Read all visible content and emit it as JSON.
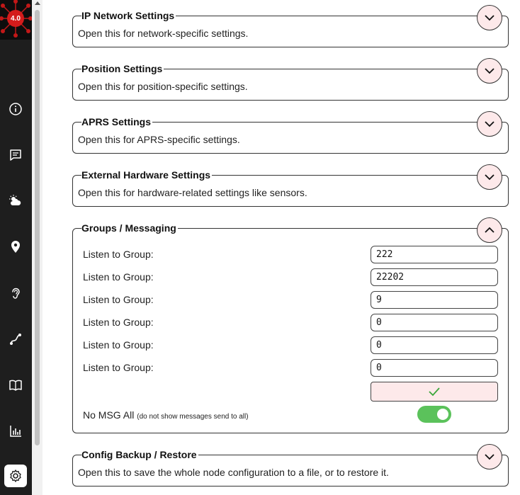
{
  "logo": {
    "version": "4.0"
  },
  "sections": {
    "ip": {
      "title": "IP Network Settings",
      "desc": "Open this for network-specific settings."
    },
    "position": {
      "title": "Position Settings",
      "desc": "Open this for position-specific settings."
    },
    "aprs": {
      "title": "APRS Settings",
      "desc": "Open this for APRS-specific settings."
    },
    "hardware": {
      "title": "External Hardware Settings",
      "desc": "Open this for hardware-related settings like sensors."
    },
    "groups": {
      "title": "Groups / Messaging",
      "rows": [
        {
          "label": "Listen to Group:",
          "value": "222"
        },
        {
          "label": "Listen to Group:",
          "value": "22202"
        },
        {
          "label": "Listen to Group:",
          "value": "9"
        },
        {
          "label": "Listen to Group:",
          "value": "0"
        },
        {
          "label": "Listen to Group:",
          "value": "0"
        },
        {
          "label": "Listen to Group:",
          "value": "0"
        }
      ],
      "no_msg_label": "No MSG All",
      "no_msg_note": "(do not show messages send to all)",
      "no_msg_enabled": true
    },
    "backup": {
      "title": "Config Backup / Restore",
      "desc": "Open this to save the whole node configuration to a file, or to restore it."
    }
  },
  "icons": {
    "nav": [
      "info-icon",
      "message-icon",
      "weather-icon",
      "location-pin-icon",
      "ear-icon",
      "route-icon",
      "book-icon",
      "chart-icon",
      "gear-icon"
    ]
  },
  "colors": {
    "sidebar": "#1e1e1e",
    "toggle_bg": "#fde9ea",
    "switch_on": "#5bc25b",
    "check": "#3aa63a",
    "logo_red": "#d41c1c"
  }
}
